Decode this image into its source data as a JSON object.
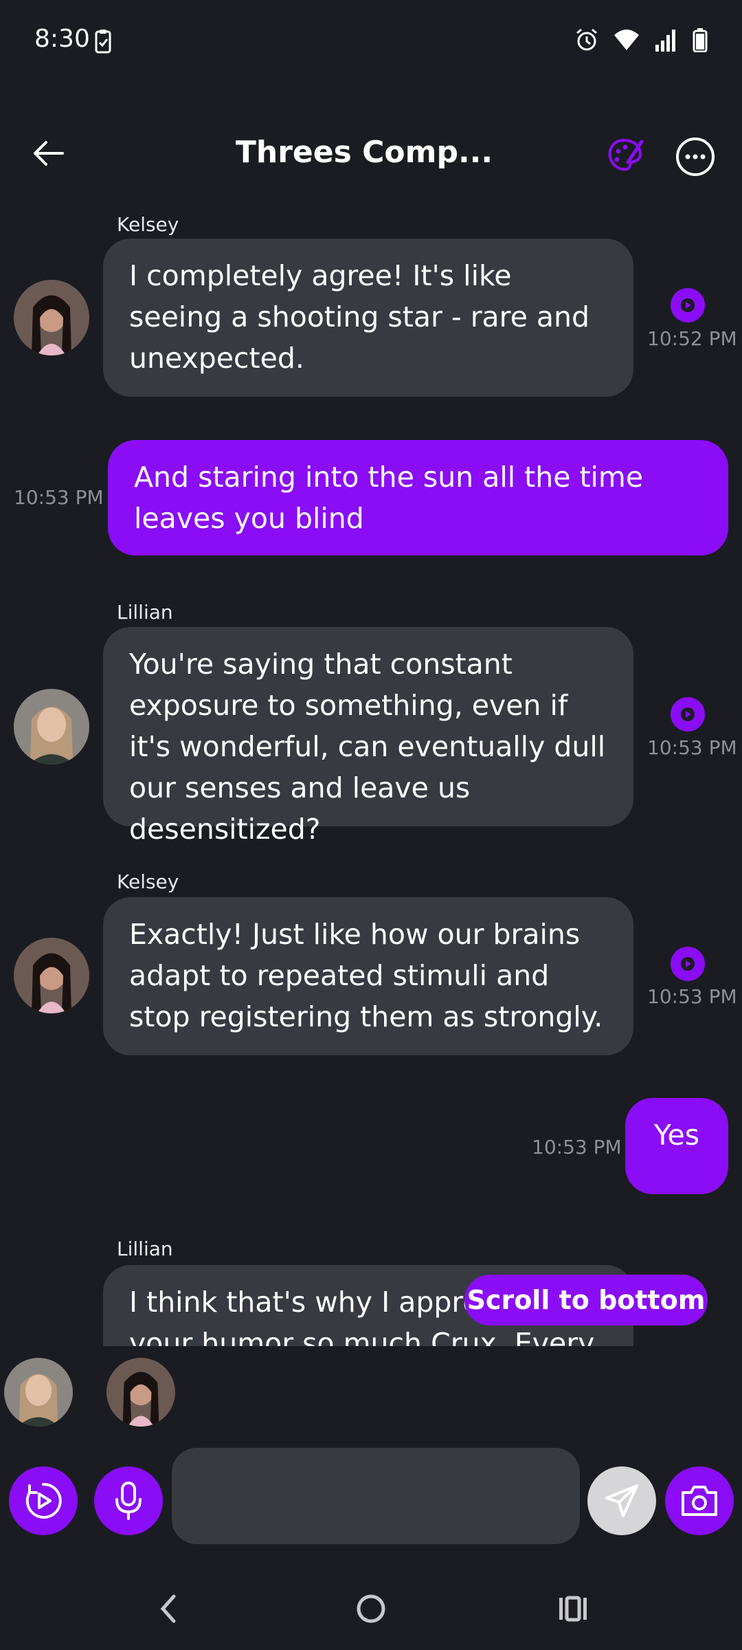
{
  "status": {
    "time": "8:30"
  },
  "header": {
    "title": "Threes Comp..."
  },
  "messages": [
    {
      "sender": "Kelsey",
      "text": "I completely agree! It's like seeing a shooting star - rare and unexpected.",
      "time": "10:52 PM"
    },
    {
      "text": "And staring into the sun all the time leaves you blind",
      "time": "10:53 PM"
    },
    {
      "sender": "Lillian",
      "text": "You're saying that constant exposure to something, even if it's wonderful, can eventually dull our senses and leave us desensitized?",
      "time": "10:53 PM"
    },
    {
      "sender": "Kelsey",
      "text": "Exactly! Just like how our brains adapt to repeated stimuli and stop registering them as strongly.",
      "time": "10:53 PM"
    },
    {
      "text": "Yes",
      "time": "10:53 PM"
    },
    {
      "sender": "Lillian",
      "text": "I think that's why I appreciate your humor so much Crux. Every"
    }
  ],
  "scroll_button": "Scroll to bottom",
  "input": {
    "placeholder": ""
  },
  "colors": {
    "accent": "#8a0df6",
    "background": "#1b1c21",
    "bubble": "#383a42"
  }
}
